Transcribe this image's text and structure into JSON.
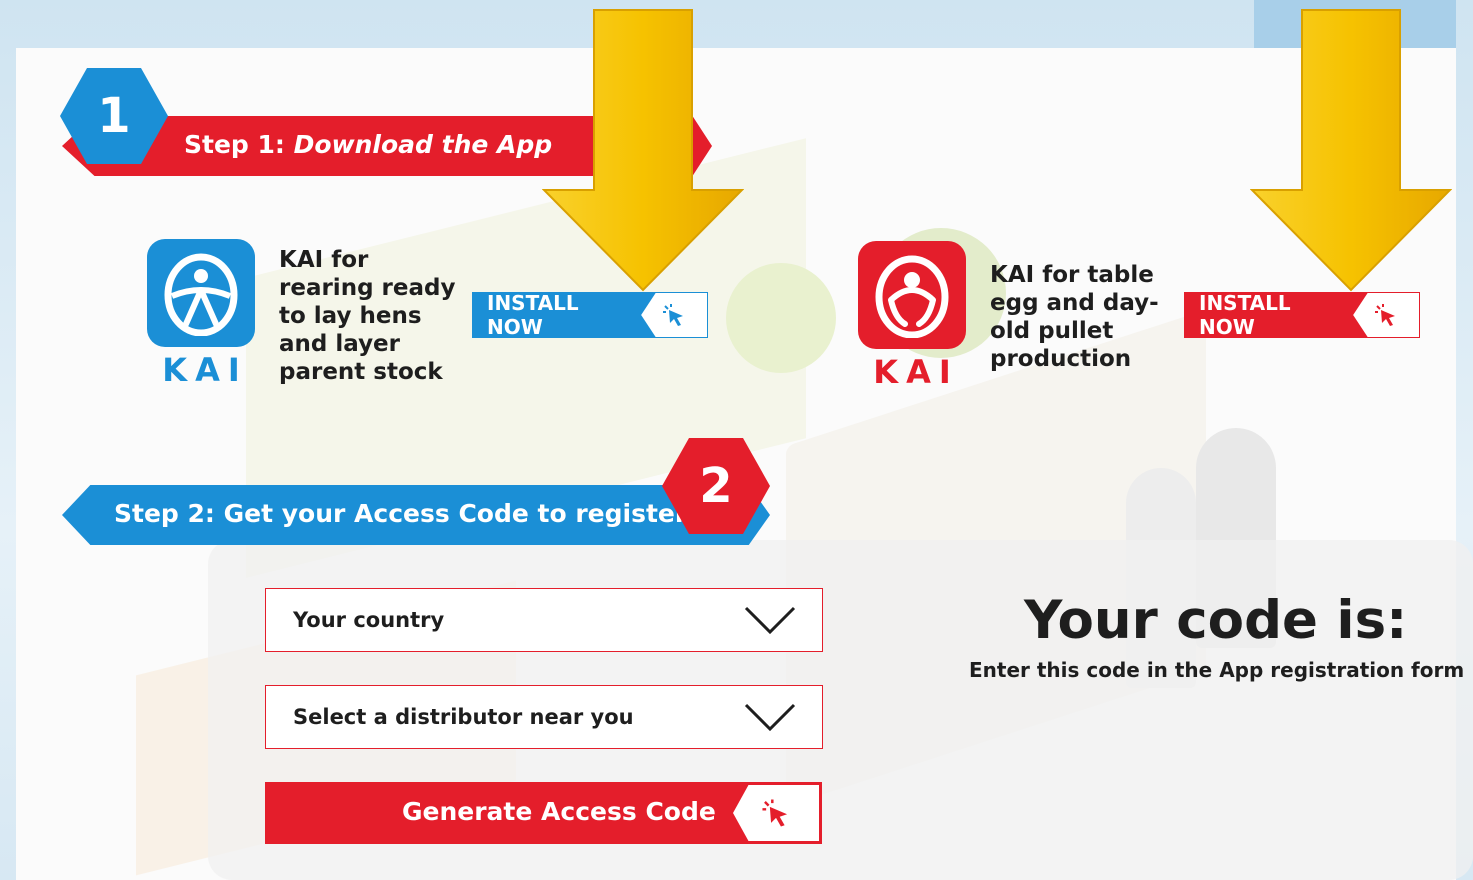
{
  "step1": {
    "number": "1",
    "prefix": "Step 1: ",
    "title": "Download the App"
  },
  "apps": [
    {
      "logo_caption": "KAI",
      "description": [
        "KAI for",
        "rearing ready",
        "to lay hens",
        "and layer",
        "parent stock"
      ],
      "install_label": "INSTALL NOW",
      "color": "#1b8fd6"
    },
    {
      "logo_caption": "KAI",
      "description": [
        "KAI for table",
        "egg and day-",
        "old pullet",
        "production"
      ],
      "install_label": "INSTALL NOW",
      "color": "#e41e2b"
    }
  ],
  "step2": {
    "number": "2",
    "title": "Step 2: Get your Access Code to register"
  },
  "form": {
    "country_select": "Your country",
    "distributor_select": "Select a distributor near you",
    "generate_button": "Generate Access Code"
  },
  "code": {
    "title": "Your code is:",
    "subtitle": "Enter this code in the App registration form"
  },
  "colors": {
    "brand_red": "#e41e2b",
    "brand_blue": "#1b8fd6",
    "arrow_yellow": "#f6c200"
  },
  "icons": {
    "install_cursor": "cursor-click-icon",
    "select_chevron": "chevron-down-icon",
    "callout_arrow": "down-arrow-icon"
  }
}
